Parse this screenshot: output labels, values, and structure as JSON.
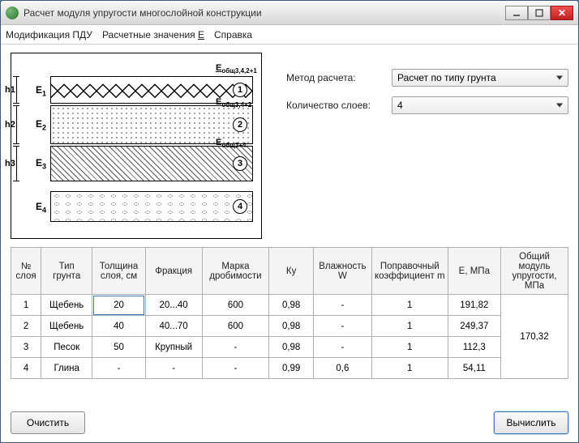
{
  "window": {
    "title": "Расчет модуля упругости многослойной конструкции"
  },
  "menu": {
    "mod": "Модификация ПДУ",
    "calc": "Расчетные значения Е",
    "help": "Справка"
  },
  "diagram": {
    "h": [
      "h1",
      "h2",
      "h3"
    ],
    "E": [
      "E₁",
      "E₂",
      "E₃",
      "E₄"
    ],
    "E_total": [
      "Еобщ3,4,2+1",
      "Еобщ3,4+2",
      "Еобщ3+4"
    ],
    "nums": [
      "1",
      "2",
      "3",
      "4"
    ]
  },
  "controls": {
    "method_label": "Метод расчета:",
    "method_value": "Расчет по типу грунта",
    "layers_label": "Количество слоев:",
    "layers_value": "4"
  },
  "table": {
    "headers": {
      "n": "№ слоя",
      "soil": "Тип грунта",
      "thick": "Толщина слоя, см",
      "frac": "Фракция",
      "crush": "Марка дробимости",
      "ku": "Ку",
      "moist": "Влажность W",
      "corr": "Поправочный коэффициент m",
      "e": "Е, МПа",
      "etot": "Общий модуль упругости, МПа"
    },
    "rows": [
      {
        "n": "1",
        "soil": "Щебень",
        "thick": "20",
        "frac": "20...40",
        "crush": "600",
        "ku": "0,98",
        "moist": "-",
        "corr": "1",
        "e": "191,82"
      },
      {
        "n": "2",
        "soil": "Щебень",
        "thick": "40",
        "frac": "40...70",
        "crush": "600",
        "ku": "0,98",
        "moist": "-",
        "corr": "1",
        "e": "249,37"
      },
      {
        "n": "3",
        "soil": "Песок",
        "thick": "50",
        "frac": "Крупный",
        "crush": "-",
        "ku": "0,98",
        "moist": "-",
        "corr": "1",
        "e": "112,3"
      },
      {
        "n": "4",
        "soil": "Глина",
        "thick": "-",
        "frac": "-",
        "crush": "-",
        "ku": "0,99",
        "moist": "0,6",
        "corr": "1",
        "e": "54,11"
      }
    ],
    "total_e": "170,32"
  },
  "buttons": {
    "clear": "Очистить",
    "calc": "Вычислить"
  }
}
